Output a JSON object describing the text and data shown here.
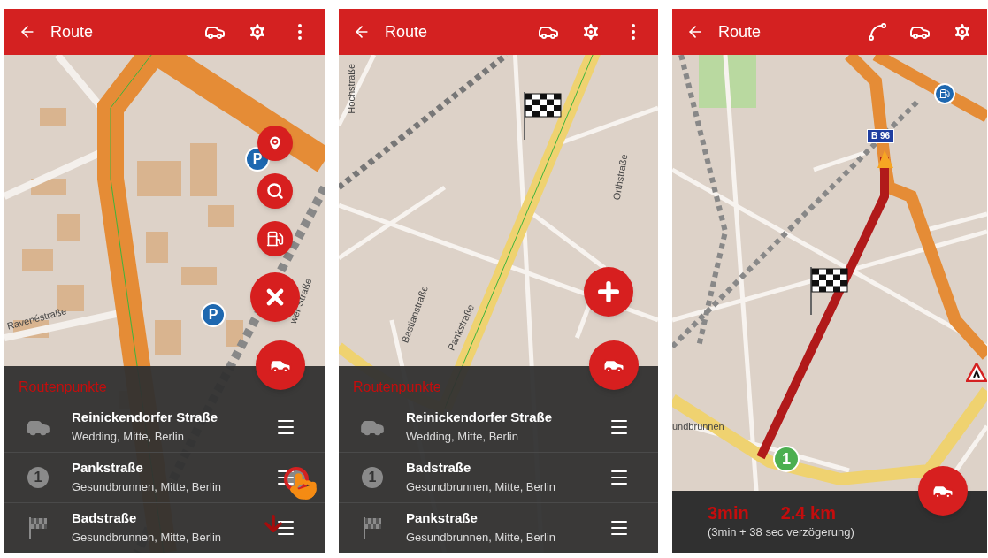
{
  "panels": [
    {
      "header": {
        "title": "Route",
        "actions": [
          {
            "kind": "car"
          },
          {
            "kind": "settings"
          },
          {
            "kind": "more"
          }
        ]
      },
      "map": {
        "labels": [
          "Ravenéstraße",
          "wer Straße"
        ],
        "markers": [
          {
            "kind": "parking",
            "label": "P"
          },
          {
            "kind": "parking",
            "label": "P"
          }
        ]
      },
      "fabs": [
        {
          "kind": "pin"
        },
        {
          "kind": "search"
        },
        {
          "kind": "fuel"
        },
        {
          "kind": "close"
        }
      ],
      "sheet": {
        "kind": "waypoints",
        "title": "Routenpunkte",
        "items": [
          {
            "kind": "car",
            "name": "Reinickendorfer Straße",
            "place": "Wedding, Mitte, Berlin",
            "dragging": false
          },
          {
            "kind": "number",
            "number": "1",
            "name": "Pankstraße",
            "place": "Gesundbrunnen, Mitte, Berlin",
            "dragging": true
          },
          {
            "kind": "flag",
            "name": "Badstraße",
            "place": "Gesundbrunnen, Mitte, Berlin",
            "dragging": false
          }
        ]
      }
    },
    {
      "header": {
        "title": "Route",
        "actions": [
          {
            "kind": "car"
          },
          {
            "kind": "settings"
          },
          {
            "kind": "more"
          }
        ]
      },
      "map": {
        "labels": [
          "Hochstraße",
          "Orthstraße",
          "Bastianstraße",
          "Pankstraße"
        ],
        "markers": [
          {
            "kind": "flag"
          }
        ]
      },
      "fabs": [
        {
          "kind": "plus"
        }
      ],
      "sheet": {
        "kind": "waypoints",
        "title": "Routenpunkte",
        "items": [
          {
            "kind": "car",
            "name": "Reinickendorfer Straße",
            "place": "Wedding, Mitte, Berlin",
            "dragging": false
          },
          {
            "kind": "number",
            "number": "1",
            "name": "Badstraße",
            "place": "Gesundbrunnen, Mitte, Berlin",
            "dragging": false
          },
          {
            "kind": "flag",
            "name": "Pankstraße",
            "place": "Gesundbrunnen, Mitte, Berlin",
            "dragging": false
          }
        ]
      }
    },
    {
      "header": {
        "title": "Route",
        "actions": [
          {
            "kind": "route"
          },
          {
            "kind": "car"
          },
          {
            "kind": "settings"
          }
        ]
      },
      "map": {
        "labels": [
          "undbrunnen"
        ],
        "markers": [
          {
            "kind": "shield",
            "label": "B 96"
          },
          {
            "kind": "flag"
          },
          {
            "kind": "number",
            "label": "1"
          },
          {
            "kind": "fuel"
          },
          {
            "kind": "warning"
          }
        ]
      },
      "sheet": {
        "kind": "summary",
        "time": "3min",
        "distance": "2.4 km",
        "detail": "(3min + 38 sec verzögerung)"
      }
    }
  ]
}
